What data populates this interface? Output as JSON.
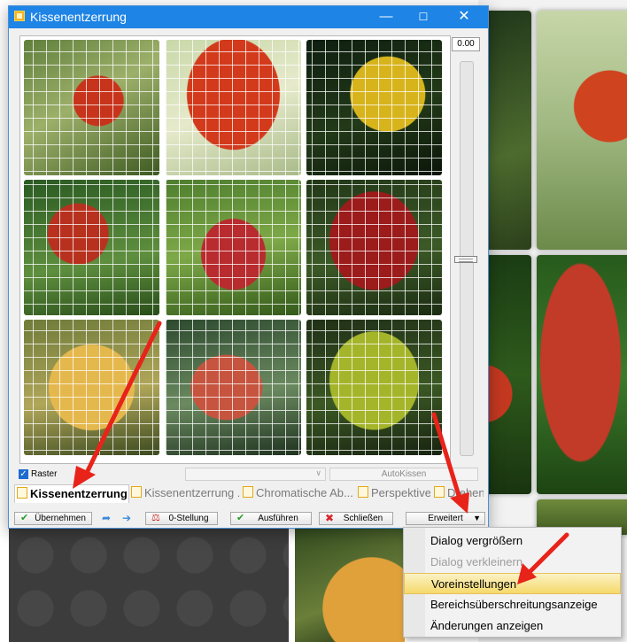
{
  "window": {
    "title": "Kissenentzerrung"
  },
  "slider": {
    "value": "0.00"
  },
  "options": {
    "raster_label": "Raster",
    "raster_checked": true,
    "autokissen_label": "AutoKissen"
  },
  "tabs": [
    {
      "label": "Kissenentzerrung",
      "active": true
    },
    {
      "label": "Kissenentzerrung ...",
      "active": false
    },
    {
      "label": "Chromatische Ab...",
      "active": false
    },
    {
      "label": "Perspektive",
      "active": false
    },
    {
      "label": "Drehen",
      "active": false
    }
  ],
  "buttons": {
    "apply": "Übernehmen",
    "zero": "0-Stellung",
    "run": "Ausführen",
    "close": "Schließen",
    "advanced": "Erweitert"
  },
  "menu": {
    "items": [
      {
        "label": "Dialog vergrößern",
        "enabled": true,
        "highlighted": false
      },
      {
        "label": "Dialog verkleinern",
        "enabled": false,
        "highlighted": false
      },
      {
        "label": "Voreinstellungen",
        "enabled": true,
        "highlighted": true
      },
      {
        "label": "Bereichsüberschreitungsanzeige",
        "enabled": true,
        "highlighted": false
      },
      {
        "label": "Änderungen anzeigen",
        "enabled": true,
        "highlighted": false
      }
    ]
  },
  "colors": {
    "titlebar": "#1e84e5",
    "highlight": "#f5d96b",
    "annotation": "#e8231a"
  }
}
